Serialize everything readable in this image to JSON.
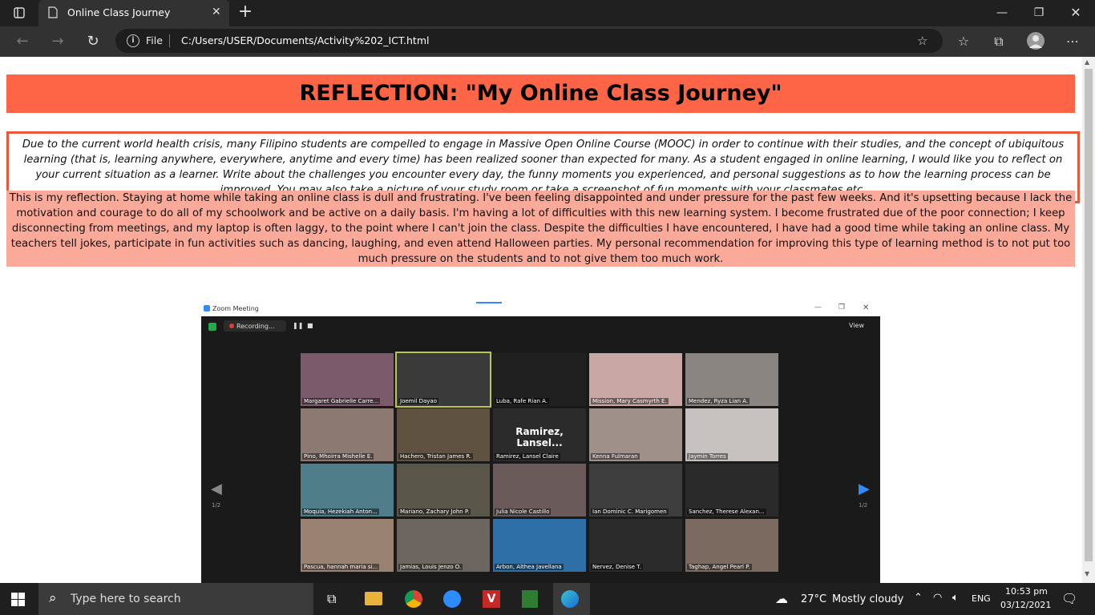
{
  "browser": {
    "tab_title": "Online Class Journey",
    "new_tab_icon": "plus-icon",
    "address": {
      "scheme_label": "File",
      "url": "C:/Users/USER/Documents/Activity%202_ICT.html"
    }
  },
  "page": {
    "heading": "REFLECTION: \"My Online Class Journey\"",
    "prompt": "Due to the current world health crisis, many Filipino students are compelled to engage in Massive Open Online Course (MOOC) in order to continue with their studies, and the concept of ubiquitous learning (that is, learning anywhere, everywhere, anytime and every time) has been realized sooner than expected for many. As a student engaged in online learning, I would like you to reflect on your current situation as a learner. Write about the challenges you encounter every day, the funny moments you experienced, and personal suggestions as to how the learning process can be improved. You may also take a picture of your study room or take a screenshot of fun moments with your classmates etc.",
    "reflection": "This is my reflection. Staying at home while taking an online class is dull and frustrating. I've been feeling disappointed and under pressure for the past few weeks. And it's upsetting because I lack the motivation and courage to do all of my schoolwork and be active on a daily basis. I'm having a lot of difficulties with this new learning system. I become frustrated due of the poor connection; I keep disconnecting from meetings, and my laptop is often laggy, to the point where I can't join the class. Despite the difficulties I have encountered, I have had a good time while taking an online class. My teachers tell jokes, participate in fun activities such as dancing, laughing, and even attend Halloween parties. My personal recommendation for improving this type of learning method is to not put too much pressure on the students and to not give them too much work.",
    "zoom": {
      "window_title": "Zoom Meeting",
      "recording": "Recording...",
      "view_label": "View",
      "page_indicator_left": "1/2",
      "page_indicator_right": "1/2",
      "big_name": "Ramirez,  Lansel...",
      "participants": [
        "Margaret Gabrielle Carre...",
        "Joemil Dayao",
        "Luba, Rafe Rian A.",
        "Mission, Mary Casmyrth E.",
        "Mendez, Ryza Lian A.",
        "Pino, Mhoirra Mishelle E.",
        "Hachero, Tristan James R.",
        "Ramirez, Lansel Claire",
        "Kenna Fulmaran",
        "Jaymin Torres",
        "Moquia, Hezekiah Anton...",
        "Mariano, Zachary John P.",
        "Julia Nicole Castillo",
        "Ian Dominic C. Marigomen",
        "Sanchez, Therese Alexan...",
        "Pascua, hannah maria si...",
        "Jamias, Louis Jenzo O.",
        "Arbon, Althea Javellana",
        "Nervez, Denise T.",
        "Taghap, Angel Pearl P."
      ]
    }
  },
  "taskbar": {
    "search_placeholder": "Type here to search",
    "weather_temp": "27°C",
    "weather_desc": "Mostly cloudy",
    "language": "ENG",
    "time": "10:53 pm",
    "date": "03/12/2021"
  },
  "colors": {
    "heading_bg": "#fe6547",
    "reflection_bg": "#fbaa9a",
    "prompt_border": "#e95839"
  }
}
